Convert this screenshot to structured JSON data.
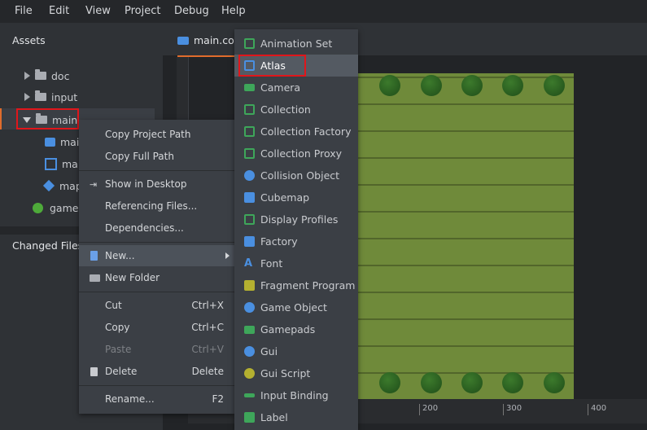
{
  "menubar": {
    "items": [
      "File",
      "Edit",
      "View",
      "Project",
      "Debug",
      "Help"
    ]
  },
  "assets": {
    "title": "Assets",
    "tree": [
      {
        "label": "doc",
        "icon": "folder-icon",
        "state": "collapsed"
      },
      {
        "label": "input",
        "icon": "folder-icon",
        "state": "collapsed"
      },
      {
        "label": "main",
        "icon": "folder-icon",
        "state": "expanded"
      },
      {
        "label": "mai",
        "icon": "collection-icon"
      },
      {
        "label": "mai",
        "icon": "atlas-grid-icon"
      },
      {
        "label": "map",
        "icon": "tilemap-icon"
      },
      {
        "label": "game.p",
        "icon": "game-project-icon"
      }
    ]
  },
  "changed_files": {
    "title": "Changed Files"
  },
  "editor": {
    "tab_label": "main.colli",
    "ruler_ticks": [
      "200",
      "300",
      "400"
    ]
  },
  "context_menu": {
    "items": [
      {
        "label": "Copy Project Path",
        "shortcut": ""
      },
      {
        "label": "Copy Full Path",
        "shortcut": ""
      },
      {
        "label": "Show in Desktop",
        "shortcut": "",
        "icon": "arrow-right-icon"
      },
      {
        "label": "Referencing Files...",
        "shortcut": ""
      },
      {
        "label": "Dependencies...",
        "shortcut": ""
      },
      {
        "label": "New...",
        "shortcut": "",
        "icon": "file-icon"
      },
      {
        "label": "New Folder",
        "shortcut": "",
        "icon": "folder-icon"
      },
      {
        "label": "Cut",
        "shortcut": "Ctrl+X"
      },
      {
        "label": "Copy",
        "shortcut": "Ctrl+C"
      },
      {
        "label": "Paste",
        "shortcut": "Ctrl+V"
      },
      {
        "label": "Delete",
        "shortcut": "Delete",
        "icon": "trash-icon"
      },
      {
        "label": "Rename...",
        "shortcut": "F2"
      }
    ]
  },
  "new_submenu": {
    "items": [
      {
        "label": "Animation Set",
        "icon": "animation-set-icon"
      },
      {
        "label": "Atlas",
        "icon": "atlas-icon"
      },
      {
        "label": "Camera",
        "icon": "camera-icon"
      },
      {
        "label": "Collection",
        "icon": "collection-icon"
      },
      {
        "label": "Collection Factory",
        "icon": "collection-factory-icon"
      },
      {
        "label": "Collection Proxy",
        "icon": "collection-proxy-icon"
      },
      {
        "label": "Collision Object",
        "icon": "collision-object-icon"
      },
      {
        "label": "Cubemap",
        "icon": "cubemap-icon"
      },
      {
        "label": "Display Profiles",
        "icon": "display-profiles-icon"
      },
      {
        "label": "Factory",
        "icon": "factory-icon"
      },
      {
        "label": "Font",
        "icon": "font-icon"
      },
      {
        "label": "Fragment Program",
        "icon": "fragment-program-icon"
      },
      {
        "label": "Game Object",
        "icon": "game-object-icon"
      },
      {
        "label": "Gamepads",
        "icon": "gamepads-icon"
      },
      {
        "label": "Gui",
        "icon": "gui-icon"
      },
      {
        "label": "Gui Script",
        "icon": "gui-script-icon"
      },
      {
        "label": "Input Binding",
        "icon": "input-binding-icon"
      },
      {
        "label": "Label",
        "icon": "label-icon"
      }
    ]
  },
  "colors": {
    "accent": "#e06c2c",
    "highlight_box": "#e0161b",
    "background": "#2b2d30"
  }
}
